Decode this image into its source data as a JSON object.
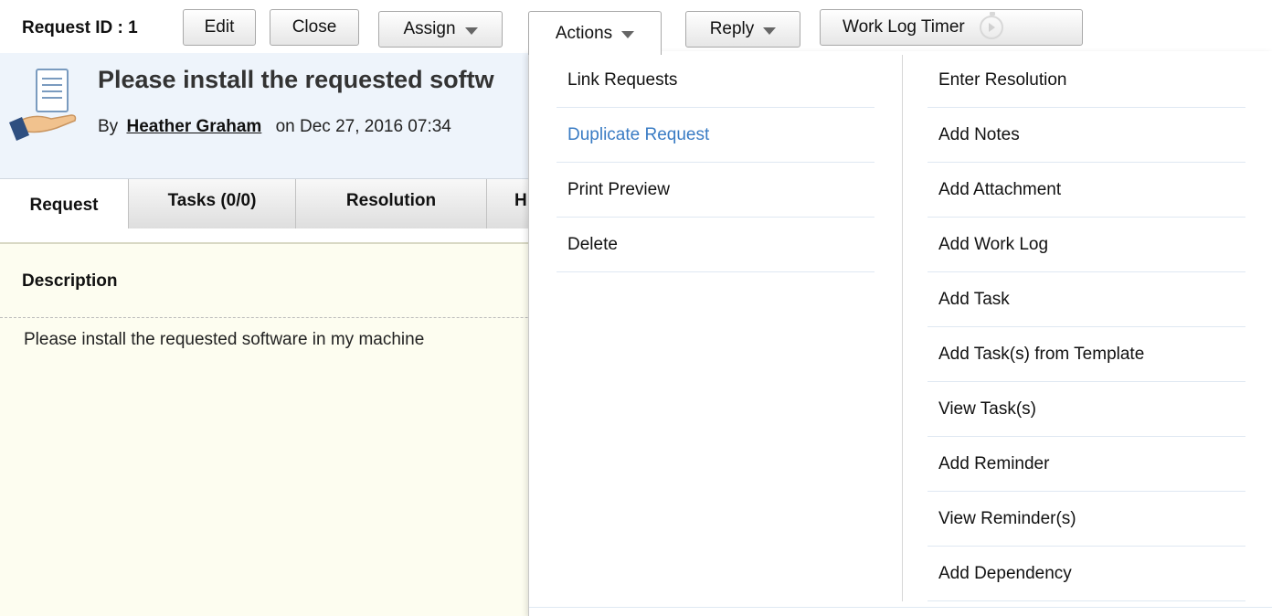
{
  "toolbar": {
    "request_id": "Request ID : 1",
    "edit": "Edit",
    "close": "Close",
    "assign": "Assign",
    "actions": "Actions",
    "reply": "Reply",
    "work_log_timer": "Work Log Timer"
  },
  "header": {
    "title": "Please install the requested softw",
    "by": "By",
    "author": "Heather Graham",
    "on_date": "on  Dec 27, 2016 07:34"
  },
  "tabs": [
    "Request",
    "Tasks (0/0)",
    "Resolution",
    "H"
  ],
  "content": {
    "description_label": "Description",
    "description_text": "Please install the requested software in my machine"
  },
  "actions_menu": {
    "left": [
      "Link Requests",
      "Duplicate Request",
      "Print Preview",
      "Delete"
    ],
    "right": [
      "Enter Resolution",
      "Add Notes",
      "Add Attachment",
      "Add Work Log",
      "Add Task",
      "Add Task(s) from Template",
      "View Task(s)",
      "Add Reminder",
      "View Reminder(s)",
      "Add Dependency"
    ],
    "highlighted": "Duplicate Request"
  },
  "colors": {
    "header_bg": "#eef4fb",
    "content_bg": "#fdfdf0",
    "highlight_link": "#3a7cc4"
  },
  "icons": [
    "request-hand-document-icon",
    "assign-caret-icon",
    "actions-caret-icon",
    "reply-caret-icon",
    "stopwatch-play-icon"
  ]
}
